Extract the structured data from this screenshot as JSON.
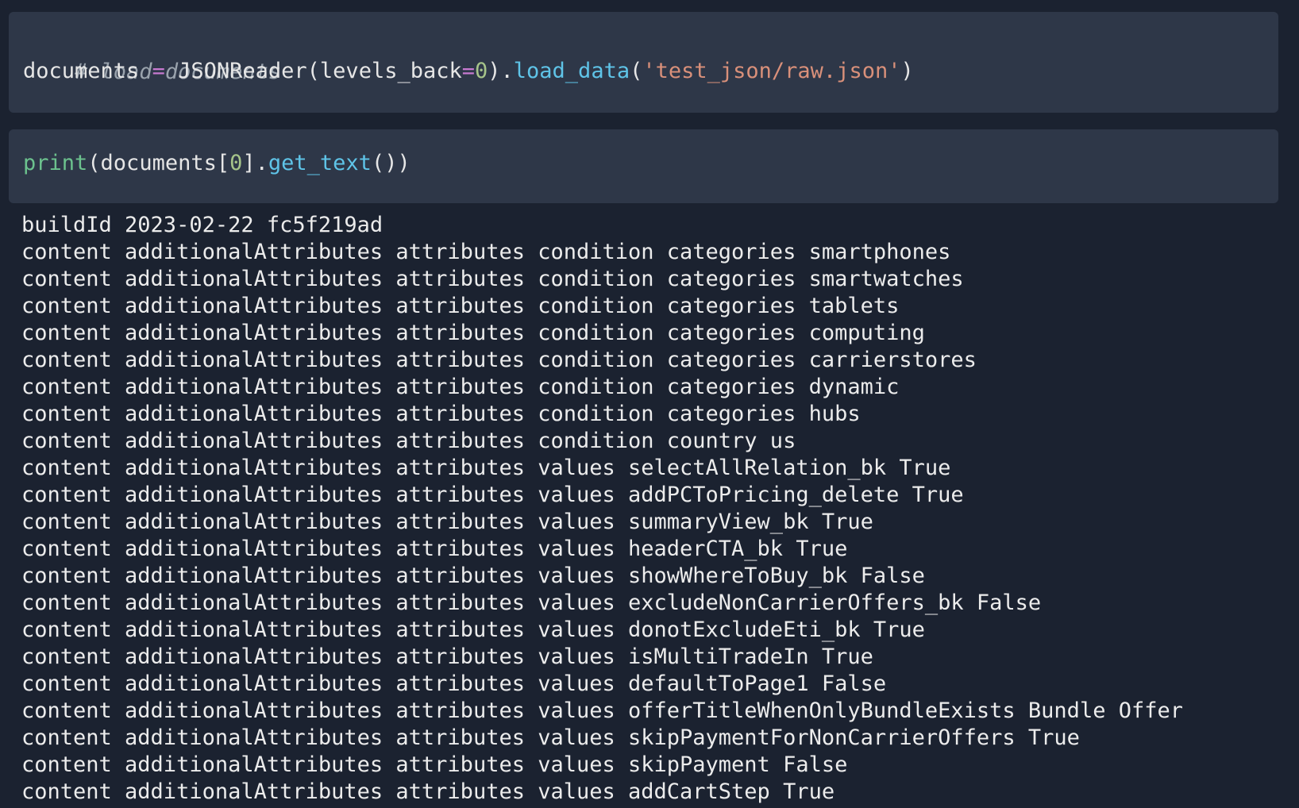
{
  "cells": [
    {
      "comment": "# load documents",
      "line2": {
        "var": "documents",
        "assign": " = ",
        "cls": "JSONReader",
        "open": "(",
        "kw": "levels_back",
        "eq": "=",
        "num": "0",
        "close": ").",
        "method": "load_data",
        "open2": "(",
        "str": "'test_json/raw.json'",
        "close2": ")"
      }
    },
    {
      "builtin": "print",
      "open": "(",
      "var": "documents[",
      "num": "0",
      "mid": "].",
      "method": "get_text",
      "close": "())"
    }
  ],
  "output": [
    "buildId 2023-02-22 fc5f219ad",
    "content additionalAttributes attributes condition categories smartphones",
    "content additionalAttributes attributes condition categories smartwatches",
    "content additionalAttributes attributes condition categories tablets",
    "content additionalAttributes attributes condition categories computing",
    "content additionalAttributes attributes condition categories carrierstores",
    "content additionalAttributes attributes condition categories dynamic",
    "content additionalAttributes attributes condition categories hubs",
    "content additionalAttributes attributes condition country us",
    "content additionalAttributes attributes values selectAllRelation_bk True",
    "content additionalAttributes attributes values addPCToPricing_delete True",
    "content additionalAttributes attributes values summaryView_bk True",
    "content additionalAttributes attributes values headerCTA_bk True",
    "content additionalAttributes attributes values showWhereToBuy_bk False",
    "content additionalAttributes attributes values excludeNonCarrierOffers_bk False",
    "content additionalAttributes attributes values donotExcludeEti_bk True",
    "content additionalAttributes attributes values isMultiTradeIn True",
    "content additionalAttributes attributes values defaultToPage1 False",
    "content additionalAttributes attributes values offerTitleWhenOnlyBundleExists Bundle Offer",
    "content additionalAttributes attributes values skipPaymentForNonCarrierOffers True",
    "content additionalAttributes attributes values skipPayment False",
    "content additionalAttributes attributes values addCartStep True"
  ]
}
